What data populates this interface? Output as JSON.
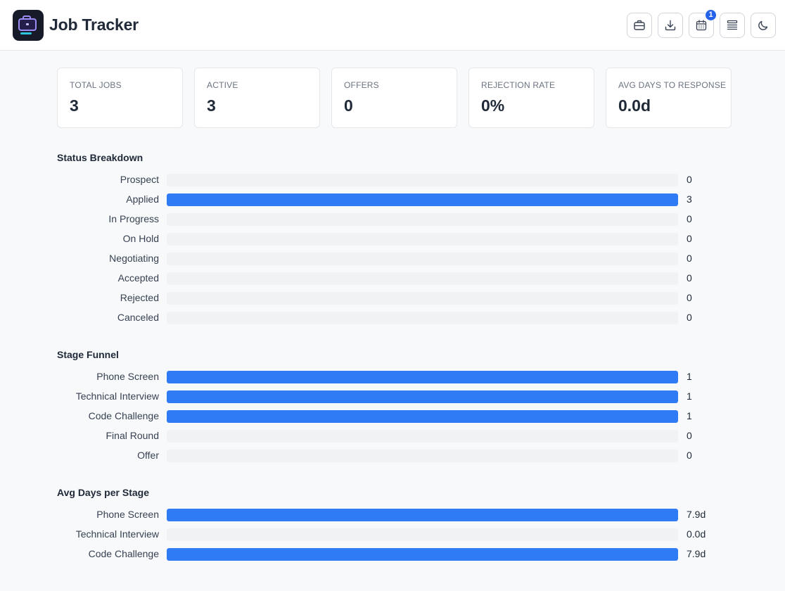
{
  "header": {
    "title": "Job Tracker",
    "notification_count": "1"
  },
  "toolbar": {
    "buttons": [
      {
        "icon": "briefcase-icon"
      },
      {
        "icon": "download-icon"
      },
      {
        "icon": "calendar-icon"
      },
      {
        "icon": "stack-icon"
      },
      {
        "icon": "moon-icon"
      }
    ]
  },
  "stats": [
    {
      "label": "TOTAL JOBS",
      "value": "3"
    },
    {
      "label": "ACTIVE",
      "value": "3"
    },
    {
      "label": "OFFERS",
      "value": "0"
    },
    {
      "label": "REJECTION RATE",
      "value": "0%"
    },
    {
      "label": "AVG DAYS TO RESPONSE",
      "value": "0.0d"
    }
  ],
  "status_breakdown": {
    "title": "Status Breakdown",
    "max": 3,
    "rows": [
      {
        "label": "Prospect",
        "value": 0,
        "display": "0"
      },
      {
        "label": "Applied",
        "value": 3,
        "display": "3"
      },
      {
        "label": "In Progress",
        "value": 0,
        "display": "0"
      },
      {
        "label": "On Hold",
        "value": 0,
        "display": "0"
      },
      {
        "label": "Negotiating",
        "value": 0,
        "display": "0"
      },
      {
        "label": "Accepted",
        "value": 0,
        "display": "0"
      },
      {
        "label": "Rejected",
        "value": 0,
        "display": "0"
      },
      {
        "label": "Canceled",
        "value": 0,
        "display": "0"
      }
    ]
  },
  "stage_funnel": {
    "title": "Stage Funnel",
    "max": 1,
    "rows": [
      {
        "label": "Phone Screen",
        "value": 1,
        "display": "1"
      },
      {
        "label": "Technical Interview",
        "value": 1,
        "display": "1"
      },
      {
        "label": "Code Challenge",
        "value": 1,
        "display": "1"
      },
      {
        "label": "Final Round",
        "value": 0,
        "display": "0"
      },
      {
        "label": "Offer",
        "value": 0,
        "display": "0"
      }
    ]
  },
  "avg_days": {
    "title": "Avg Days per Stage",
    "max": 7.9,
    "rows": [
      {
        "label": "Phone Screen",
        "value": 7.9,
        "display": "7.9d"
      },
      {
        "label": "Technical Interview",
        "value": 0.0,
        "display": "0.0d"
      },
      {
        "label": "Code Challenge",
        "value": 7.9,
        "display": "7.9d"
      }
    ]
  },
  "colors": {
    "accent": "#2f7af5",
    "track": "#f1f2f4",
    "badge": "#2563eb"
  }
}
